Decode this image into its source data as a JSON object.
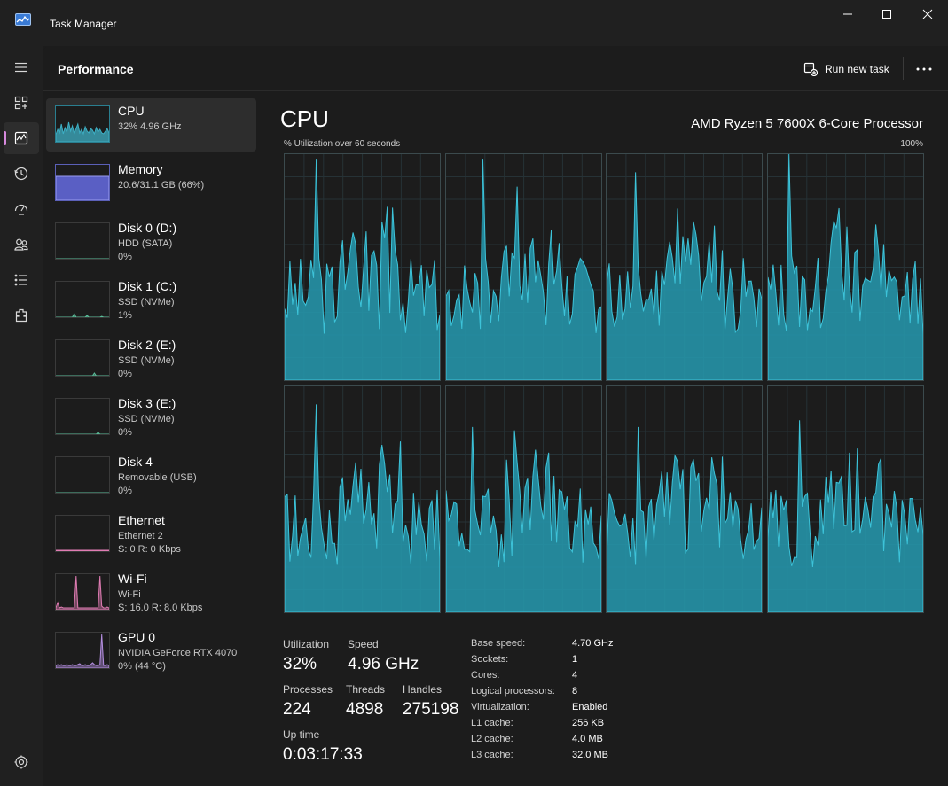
{
  "window": {
    "title": "Task Manager"
  },
  "header": {
    "title": "Performance",
    "run_new_task": "Run new task"
  },
  "nav": {
    "items": [
      {
        "icon": "hamburger-icon"
      },
      {
        "icon": "processes-icon"
      },
      {
        "icon": "performance-icon",
        "active": true
      },
      {
        "icon": "app-history-icon"
      },
      {
        "icon": "startup-apps-icon"
      },
      {
        "icon": "users-icon"
      },
      {
        "icon": "details-icon"
      },
      {
        "icon": "services-icon"
      },
      {
        "icon": "settings-icon"
      }
    ]
  },
  "resources": [
    {
      "name": "CPU",
      "lines": [
        "32%  4.96 GHz"
      ],
      "color": "#3dafc4"
    },
    {
      "name": "Memory",
      "lines": [
        "20.6/31.1 GB (66%)"
      ],
      "color": "#8a8de8"
    },
    {
      "name": "Disk 0 (D:)",
      "lines": [
        "HDD (SATA)",
        "0%"
      ],
      "color": "#5bbd9a"
    },
    {
      "name": "Disk 1 (C:)",
      "lines": [
        "SSD (NVMe)",
        "1%"
      ],
      "color": "#5bbd9a"
    },
    {
      "name": "Disk 2 (E:)",
      "lines": [
        "SSD (NVMe)",
        "0%"
      ],
      "color": "#5bbd9a"
    },
    {
      "name": "Disk 3 (E:)",
      "lines": [
        "SSD (NVMe)",
        "0%"
      ],
      "color": "#5bbd9a"
    },
    {
      "name": "Disk 4",
      "lines": [
        "Removable (USB)",
        "0%"
      ],
      "color": "#5bbd9a"
    },
    {
      "name": "Ethernet",
      "lines": [
        "Ethernet 2",
        "S: 0 R: 0 Kbps"
      ],
      "color": "#e07cb3"
    },
    {
      "name": "Wi-Fi",
      "lines": [
        "Wi-Fi",
        "S: 16.0 R: 8.0 Kbps"
      ],
      "color": "#e07cb3"
    },
    {
      "name": "GPU 0",
      "lines": [
        "NVIDIA GeForce RTX 4070",
        "0%  (44 °C)"
      ],
      "color": "#b48ee0"
    }
  ],
  "cpu": {
    "title": "CPU",
    "model": "AMD Ryzen 5 7600X 6-Core Processor",
    "graph_label": "% Utilization over 60 seconds",
    "graph_max": "100%",
    "stats": {
      "utilization_label": "Utilization",
      "utilization": "32%",
      "speed_label": "Speed",
      "speed": "4.96 GHz",
      "processes_label": "Processes",
      "processes": "224",
      "threads_label": "Threads",
      "threads": "4898",
      "handles_label": "Handles",
      "handles": "275198",
      "uptime_label": "Up time",
      "uptime": "0:03:17:33"
    },
    "info": [
      {
        "key": "Base speed:",
        "value": "4.70 GHz"
      },
      {
        "key": "Sockets:",
        "value": "1"
      },
      {
        "key": "Cores:",
        "value": "4"
      },
      {
        "key": "Logical processors:",
        "value": "8"
      },
      {
        "key": "Virtualization:",
        "value": "Enabled"
      },
      {
        "key": "L1 cache:",
        "value": "256 KB"
      },
      {
        "key": "L2 cache:",
        "value": "4.0 MB"
      },
      {
        "key": "L3 cache:",
        "value": "32.0 MB"
      }
    ]
  },
  "colors": {
    "cpu_line": "#3dc3d9",
    "cpu_fill": "#2694a9",
    "accent": "#d689dd"
  }
}
